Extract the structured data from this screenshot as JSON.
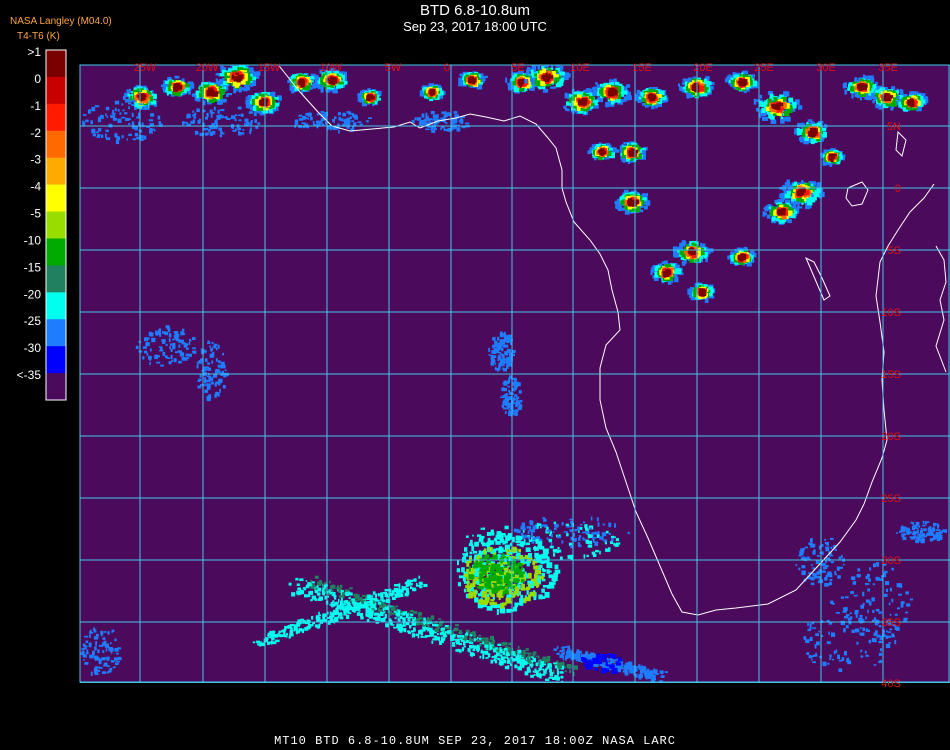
{
  "header": {
    "title": "BTD 6.8-10.8um",
    "subtitle": "Sep 23, 2017 18:00 UTC",
    "brand": "NASA Langley (M04.0)",
    "units": "T4-T6 (K)"
  },
  "legend": {
    "entries": [
      {
        "label": ">1",
        "color": "#7a0000"
      },
      {
        "label": "0",
        "color": "#c80000"
      },
      {
        "label": "-1",
        "color": "#ff1a00"
      },
      {
        "label": "-2",
        "color": "#ff6a00"
      },
      {
        "label": "-3",
        "color": "#ffaa00"
      },
      {
        "label": "-4",
        "color": "#ffff00"
      },
      {
        "label": "-5",
        "color": "#99dd00"
      },
      {
        "label": "-10",
        "color": "#00aa00"
      },
      {
        "label": "-15",
        "color": "#208060"
      },
      {
        "label": "-20",
        "color": "#00ffee"
      },
      {
        "label": "-25",
        "color": "#1e7cff"
      },
      {
        "label": "-30",
        "color": "#0000ff"
      },
      {
        "label": "<-35",
        "color": "#4c0a5c"
      }
    ]
  },
  "map": {
    "background": "#4c0a5c",
    "grid_color": "#3fc7ea",
    "label_color": "#e01010",
    "coast_color": "#ffffff",
    "lon_labels": [
      "25W",
      "20W",
      "15W",
      "10W",
      "5W",
      "0",
      "5E",
      "10E",
      "15E",
      "20E",
      "25E",
      "30E",
      "35E"
    ],
    "lat_labels": [
      "5N",
      "0",
      "5S",
      "10S",
      "15S",
      "20S",
      "25S",
      "30S",
      "35S",
      "40S"
    ]
  },
  "footer": {
    "caption": "MT10  BTD 6.8-10.8UM   SEP 23, 2017 18:00Z   NASA LARC"
  }
}
